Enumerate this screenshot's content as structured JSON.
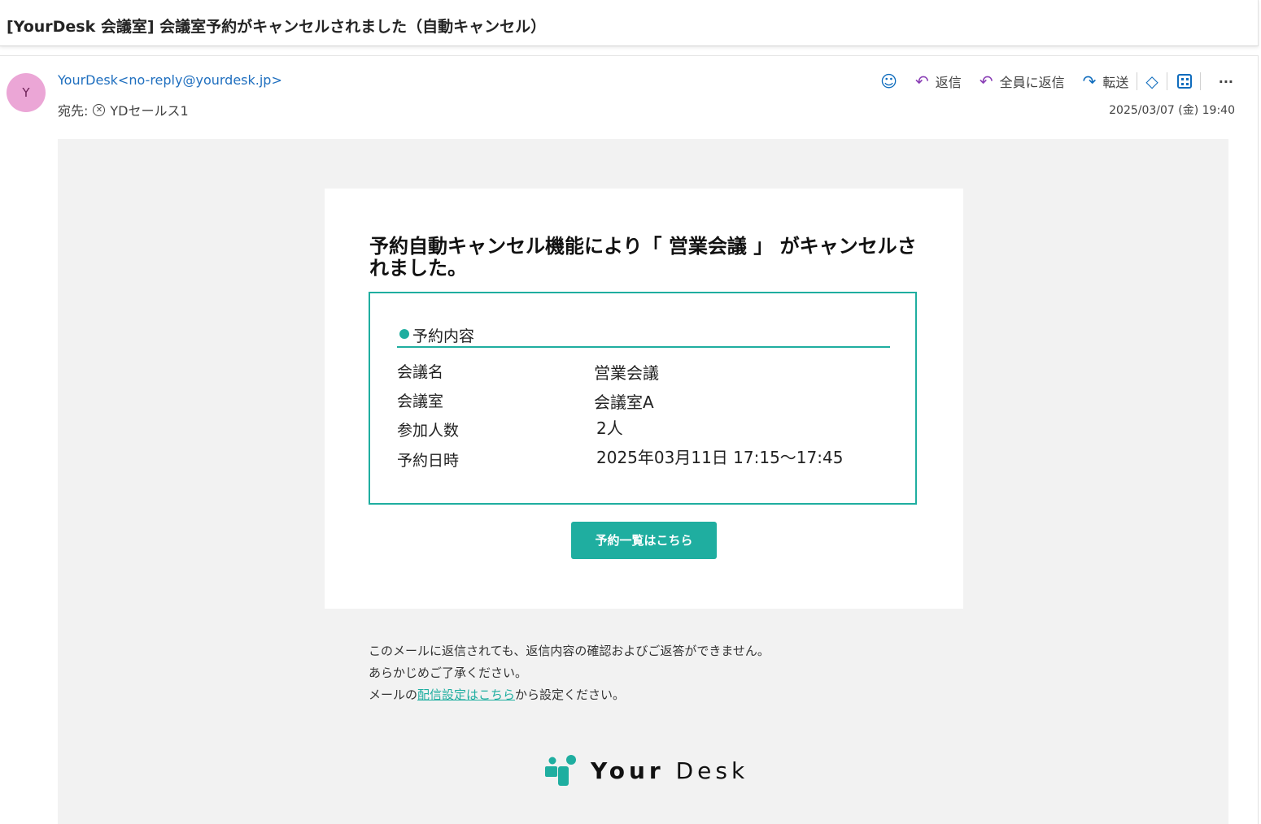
{
  "subject": "[YourDesk 会議室] 会議室予約がキャンセルされました（自動キャンセル）",
  "sender": {
    "avatar_initial": "Y",
    "display": "YourDesk<no-reply@yourdesk.jp>",
    "to_label": "宛先:",
    "to_name": "YDセールス1"
  },
  "toolbar": {
    "reply": "返信",
    "reply_all": "全員に返信",
    "forward": "転送",
    "more": "···"
  },
  "timestamp": "2025/03/07 (金) 19:40",
  "email": {
    "title": "予約自動キャンセル機能により「 営業会議 」 がキャンセルされました。",
    "section_header": "予約内容",
    "rows": [
      {
        "label": "会議名",
        "value": "営業会議"
      },
      {
        "label": "会議室",
        "value": "会議室A"
      },
      {
        "label": "参加人数",
        "value": "2人"
      },
      {
        "label": "予約日時",
        "value": "2025年03月11日 17:15〜17:45"
      }
    ],
    "cta_label": "予約一覧はこちら",
    "footer_line1": "このメールに返信されても、返信内容の確認およびご返答ができません。",
    "footer_line2": "あらかじめご了承ください。",
    "footer_line3_prefix": "メールの",
    "footer_link": "配信設定はこちら",
    "footer_line3_suffix": "から設定ください。",
    "logo_text_bold": "Your",
    "logo_text_light": "Desk"
  },
  "colors": {
    "accent": "#1faea0",
    "link": "#1f6fbf",
    "avatar_bg": "#eba6d6"
  }
}
